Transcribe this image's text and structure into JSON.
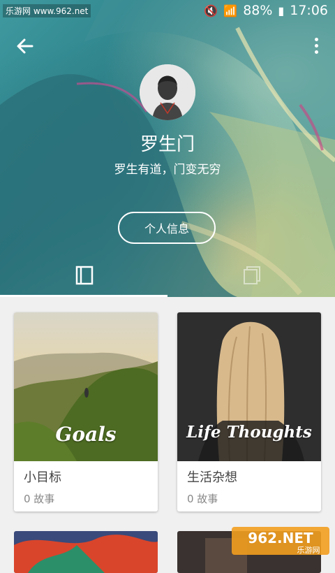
{
  "status": {
    "watermark": "乐游网 www.962.net",
    "battery": "88%",
    "time": "17:06"
  },
  "profile": {
    "name": "罗生门",
    "motto": "罗生有道，门变无穷",
    "info_button": "个人信息"
  },
  "cards": [
    {
      "title": "小目标",
      "count": "0 故事",
      "cover_text": "Goals"
    },
    {
      "title": "生活杂想",
      "count": "0 故事",
      "cover_text": "Life Thoughts"
    }
  ],
  "watermark_br": {
    "text": "962.NET",
    "sub": "乐游网"
  },
  "colors": {
    "hero_teal": "#2a7c84",
    "background": "#f0f0f0"
  }
}
